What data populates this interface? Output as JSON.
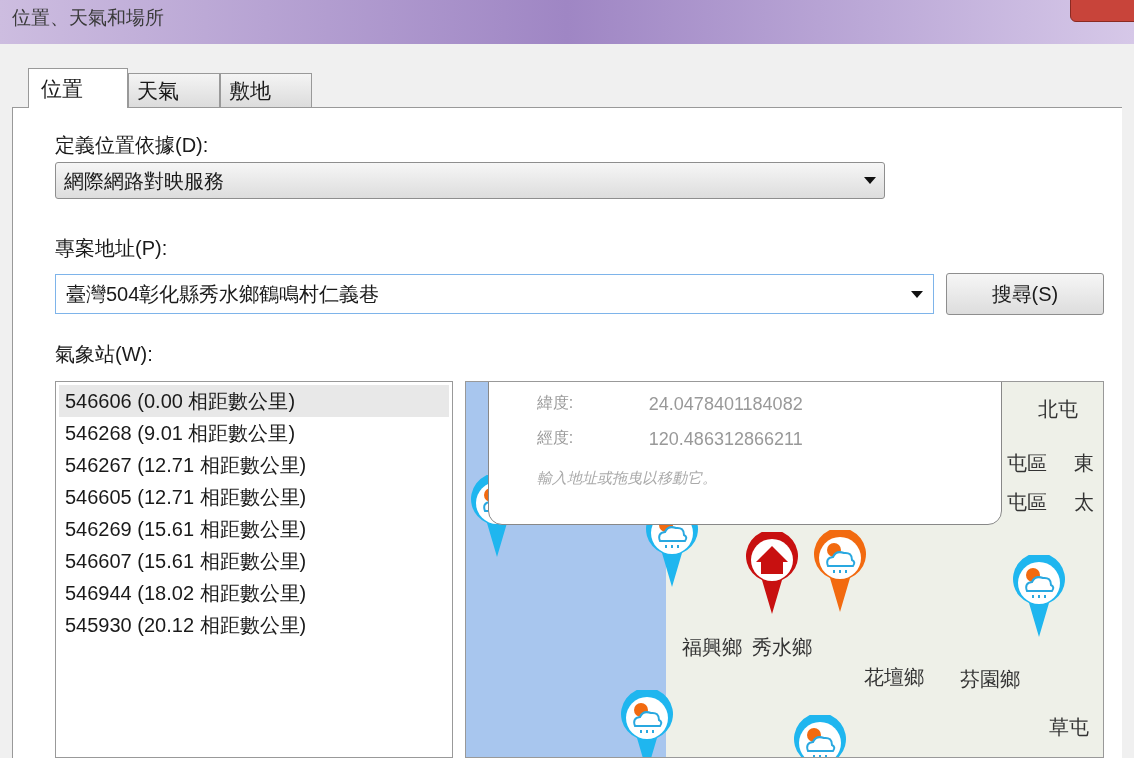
{
  "window": {
    "title": "位置、天氣和場所"
  },
  "tabs": [
    {
      "label": "位置",
      "selected": true
    },
    {
      "label": "天氣",
      "selected": false
    },
    {
      "label": "敷地",
      "selected": false
    }
  ],
  "location_source": {
    "label": "定義位置依據(D):",
    "value": "網際網路對映服務"
  },
  "address": {
    "label": "專案地址(P):",
    "value": "臺灣504彰化縣秀水鄉鶴鳴村仁義巷",
    "search_button": "搜尋(S)"
  },
  "stations": {
    "label": "氣象站(W):",
    "items": [
      {
        "text": "546606 (0.00 相距數公里)",
        "selected": true
      },
      {
        "text": "546268 (9.01 相距數公里)",
        "selected": false
      },
      {
        "text": "546267 (12.71 相距數公里)",
        "selected": false
      },
      {
        "text": "546605 (12.71 相距數公里)",
        "selected": false
      },
      {
        "text": "546269 (15.61 相距數公里)",
        "selected": false
      },
      {
        "text": "546607 (15.61 相距數公里)",
        "selected": false
      },
      {
        "text": "546944 (18.02 相距數公里)",
        "selected": false
      },
      {
        "text": "545930 (20.12 相距數公里)",
        "selected": false
      }
    ]
  },
  "map": {
    "popup": {
      "rows": [
        {
          "label": "緯度:",
          "value": "24.0478401184082"
        },
        {
          "label": "經度:",
          "value": "120.486312866211"
        }
      ],
      "hint": "輸入地址或拖曳以移動它。"
    },
    "places": [
      {
        "text": "北屯"
      },
      {
        "text": "屯區"
      },
      {
        "text": "東"
      },
      {
        "text": "屯區"
      },
      {
        "text": "太"
      },
      {
        "text": "福興鄉"
      },
      {
        "text": "秀水鄉"
      },
      {
        "text": "花壇鄉"
      },
      {
        "text": "芬園鄉"
      },
      {
        "text": "草屯"
      }
    ],
    "pins": [
      {
        "kind": "weather",
        "color": "#1fb6ef"
      },
      {
        "kind": "weather",
        "color": "#1fb6ef"
      },
      {
        "kind": "home",
        "color": "#c81010"
      },
      {
        "kind": "weather",
        "color": "#f26a10"
      },
      {
        "kind": "weather",
        "color": "#1fb6ef"
      },
      {
        "kind": "weather",
        "color": "#1fb6ef"
      },
      {
        "kind": "weather",
        "color": "#1fb6ef"
      }
    ]
  }
}
